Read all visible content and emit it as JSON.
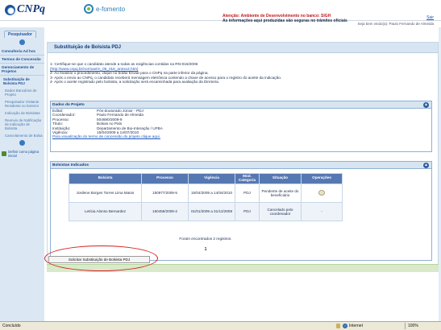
{
  "header": {
    "logo_text": "CNPq",
    "efomento_text": "e-fomento",
    "alert_line1": "Atenção: Ambiente de Desenvolvimento no banco: SIGH",
    "alert_line2": "As informações aqui produzidas são seguras no trâmites oficiais",
    "sair": "Sair",
    "welcome": "Seja bem vindo(a): Paulo Fernando de Almeida"
  },
  "left_nav": {
    "tab": "Pesquisador",
    "sections": [
      {
        "label": "Consultoria Ad hoc"
      },
      {
        "label": "Termos de Concessão"
      },
      {
        "label": "Gerenciamento de Projetos"
      }
    ],
    "items": [
      "Substituição de Bolsista PDJ",
      "Dados Bancários de Projeto",
      "Pesquisador Visitante Residente no Exterior",
      "Indicação de Bolsistas",
      "Reenvio de Notificação de Indicação de Bolsista",
      "Cancelamento de Bolsa"
    ],
    "home": "Definir como página inicial"
  },
  "page": {
    "title": "Substituição de Bolsista PDJ",
    "instructions": [
      "1- Certifique-se que o candidato atende a todas as exigências contidas na RN-016/2006",
      "(http://www.cnpq.br/normas/rn_06_016_anexo4.htm).",
      "2- Ao finalizar o procedimento, clique no botão Enviar para o CNPq na parte inferior da página.",
      "3- Após o envio ao CNPq, o candidato receberá mensagem eletrônica contendo a chave de acesso para o registro do aceite da indicação.",
      "4- Após o aceite registrado pelo bolsista, a solicitação será encaminhada para avaliação da Diretoria."
    ],
    "instructions_link": "(http://www.cnpq.br/normas/rn_06_016_anexo4.htm)"
  },
  "project": {
    "title": "Dados do Projeto",
    "fields": [
      {
        "k": "Edital:",
        "v": "Pós-doutorado Júnior - PDJ"
      },
      {
        "k": "Coordenador:",
        "v": "Paulo Fernando de Almeida"
      },
      {
        "k": "Processo:",
        "v": "504690/2009-9"
      },
      {
        "k": "Título:",
        "v": "Bolsas no País"
      },
      {
        "k": "Instituição:",
        "v": "Departamento de Bio-Interação / UFBA"
      },
      {
        "k": "Vigência:",
        "v": "15/04/2009 a 14/07/2010"
      }
    ],
    "link": "Para visualização do termo de concessão do projeto clique aqui."
  },
  "bolsistas": {
    "title": "Bolsistas Indicados",
    "headers": [
      "Bolsista",
      "Processo",
      "Vigência",
      "Mod. Categoria",
      "Situação",
      "Operações"
    ],
    "rows": [
      {
        "bolsista": "Josilene Borges Torres Lima Matos",
        "processo": "150977/2009-5",
        "vigencia": "15/04/2009 a 14/04/2010",
        "modcat": "PDJ",
        "situacao": "Pendente de aceite do beneficiário",
        "op": ""
      },
      {
        "bolsista": "Letícia Alonso Bernardez",
        "processo": "150459/2009-2",
        "vigencia": "01/01/2009 a 31/12/2009",
        "modcat": "PDJ",
        "situacao": "Cancelado pelo coordenador",
        "op": "-"
      }
    ],
    "found": "Foram encontrados 2 registros.",
    "page": "1"
  },
  "actions": {
    "solicitar": "Solicitar Substituição de Bolsista PDJ"
  },
  "statusbar": {
    "status": "Concluído",
    "zone": "Internet",
    "zoom": "100%"
  },
  "colors": {
    "table_header": "#5578b3",
    "title_bar": "#d7e5f2",
    "alert_red": "#c0151b",
    "highlight_ellipse": "#d41f1f"
  }
}
